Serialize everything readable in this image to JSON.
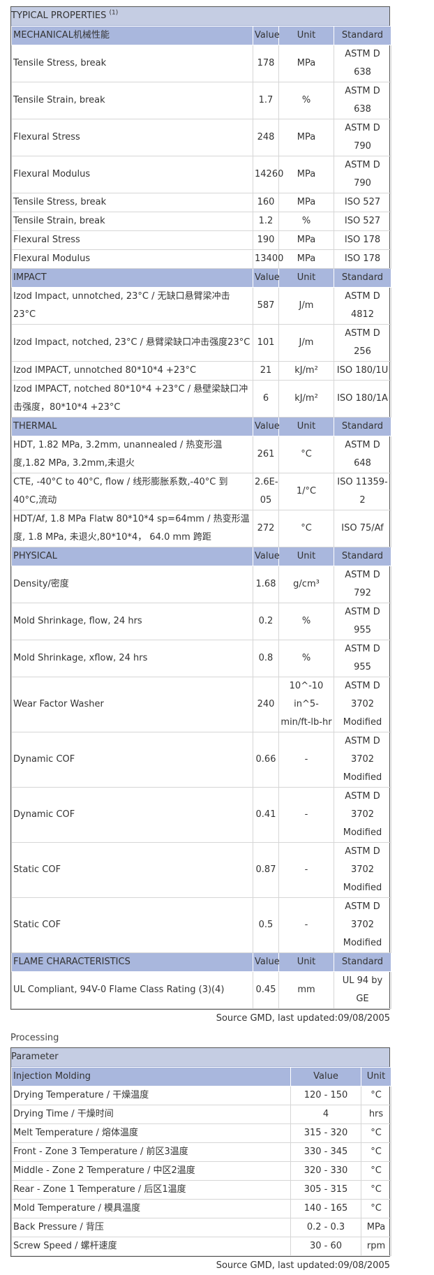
{
  "typical": {
    "title": "TYPICAL PROPERTIES",
    "title_sup": "(1)",
    "sections": [
      {
        "name": "MECHANICAL机械性能",
        "rows": [
          {
            "p": "Tensile Stress, break",
            "v": "178",
            "u": "MPa",
            "s": "ASTM D 638"
          },
          {
            "p": "Tensile Strain, break",
            "v": "1.7",
            "u": "%",
            "s": "ASTM D 638"
          },
          {
            "p": "Flexural Stress",
            "v": "248",
            "u": "MPa",
            "s": "ASTM D 790"
          },
          {
            "p": "Flexural Modulus",
            "v": "14260",
            "u": "MPa",
            "s": "ASTM D 790"
          },
          {
            "p": "Tensile Stress, break",
            "v": "160",
            "u": "MPa",
            "s": "ISO 527"
          },
          {
            "p": "Tensile Strain, break",
            "v": "1.2",
            "u": "%",
            "s": "ISO 527"
          },
          {
            "p": "Flexural Stress",
            "v": "190",
            "u": "MPa",
            "s": "ISO 178"
          },
          {
            "p": "Flexural Modulus",
            "v": "13400",
            "u": "MPa",
            "s": "ISO 178"
          }
        ]
      },
      {
        "name": "IMPACT",
        "rows": [
          {
            "p": "Izod Impact, unnotched, 23°C / 无缺口悬臂梁冲击 23°C",
            "v": "587",
            "u": "J/m",
            "s": "ASTM D 4812"
          },
          {
            "p": "Izod Impact, notched, 23°C / 悬臂梁缺口冲击强度23°C",
            "v": "101",
            "u": "J/m",
            "s": "ASTM D 256"
          },
          {
            "p": "Izod IMPACT, unnotched 80*10*4 +23°C",
            "v": "21",
            "u": "kJ/m²",
            "s": "ISO 180/1U"
          },
          {
            "p": "Izod IMPACT, notched 80*10*4 +23°C / 悬壁梁缺口冲击强度，80*10*4 +23°C",
            "v": "6",
            "u": "kJ/m²",
            "s": "ISO 180/1A"
          }
        ]
      },
      {
        "name": "THERMAL",
        "rows": [
          {
            "p": "HDT, 1.82 MPa, 3.2mm, unannealed / 热变形温度,1.82 MPa, 3.2mm,未退火",
            "v": "261",
            "u": "°C",
            "s": "ASTM D 648"
          },
          {
            "p": "CTE, -40°C to 40°C, flow / 线形膨胀系数,-40°C 到40°C,流动",
            "v": "2.6E-05",
            "u": "1/°C",
            "s": "ISO 11359-2"
          },
          {
            "p": "HDT/Af, 1.8 MPa Flatw 80*10*4 sp=64mm / 热变形温度, 1.8 MPa, 未退火,80*10*4， 64.0 mm 跨距",
            "v": "272",
            "u": "°C",
            "s": "ISO 75/Af"
          }
        ]
      },
      {
        "name": "PHYSICAL",
        "rows": [
          {
            "p": "Density/密度",
            "v": "1.68",
            "u": "g/cm³",
            "s": "ASTM D 792"
          },
          {
            "p": "Mold Shrinkage, flow, 24 hrs",
            "v": "0.2",
            "u": "%",
            "s": "ASTM D 955"
          },
          {
            "p": "Mold Shrinkage, xflow, 24 hrs",
            "v": "0.8",
            "u": "%",
            "s": "ASTM D 955"
          },
          {
            "p": "Wear Factor Washer",
            "v": "240",
            "u": "10^-10 in^5-min/ft-lb-hr",
            "s": "ASTM D 3702 Modified"
          },
          {
            "p": "Dynamic COF",
            "v": "0.66",
            "u": "-",
            "s": "ASTM D 3702 Modified"
          },
          {
            "p": "Dynamic COF",
            "v": "0.41",
            "u": "-",
            "s": "ASTM D 3702 Modified"
          },
          {
            "p": "Static COF",
            "v": "0.87",
            "u": "-",
            "s": "ASTM D 3702 Modified"
          },
          {
            "p": "Static COF",
            "v": "0.5",
            "u": "-",
            "s": "ASTM D 3702 Modified"
          }
        ]
      },
      {
        "name": "FLAME CHARACTERISTICS",
        "rows": [
          {
            "p": "UL Compliant, 94V-0 Flame Class Rating (3)(4)",
            "v": "0.45",
            "u": "mm",
            "s": "UL 94 by GE"
          }
        ]
      }
    ],
    "col_value": "Value",
    "col_unit": "Unit",
    "col_standard": "Standard",
    "source": "Source GMD, last updated:09/08/2005"
  },
  "processing": {
    "label": "Processing",
    "param_header": "Parameter",
    "section": "Injection Molding",
    "col_value": "Value",
    "col_unit": "Unit",
    "rows": [
      {
        "p": "Drying Temperature / 干燥温度",
        "v": "120 - 150",
        "u": "°C"
      },
      {
        "p": "Drying Time / 干燥时间",
        "v": "4",
        "u": "hrs"
      },
      {
        "p": "Melt Temperature / 熔体温度",
        "v": "315 - 320",
        "u": "°C"
      },
      {
        "p": "Front - Zone 3 Temperature / 前区3温度",
        "v": "330 - 345",
        "u": "°C"
      },
      {
        "p": "Middle - Zone 2 Temperature / 中区2温度",
        "v": "320 - 330",
        "u": "°C"
      },
      {
        "p": "Rear - Zone 1 Temperature / 后区1温度",
        "v": "305 - 315",
        "u": "°C"
      },
      {
        "p": "Mold Temperature / 模具温度",
        "v": "140 - 165",
        "u": "°C"
      },
      {
        "p": "Back Pressure / 背压",
        "v": "0.2 - 0.3",
        "u": "MPa"
      },
      {
        "p": "Screw Speed / 螺杆速度",
        "v": "30 - 60",
        "u": "rpm"
      }
    ],
    "source": "Source GMD, last updated:09/08/2005"
  }
}
